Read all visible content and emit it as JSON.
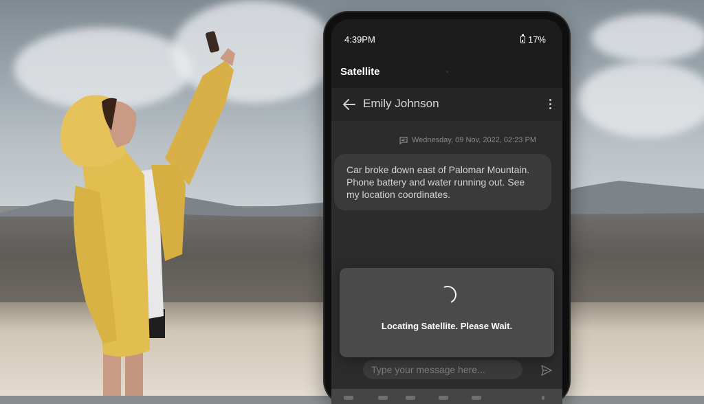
{
  "status_bar": {
    "time": "4:39PM",
    "battery": "17%"
  },
  "app": {
    "title": "Satellite"
  },
  "chat_header": {
    "contact_name": "Emily Johnson"
  },
  "conversation": {
    "timestamp": "Wednesday, 09 Nov, 2022, 02:23 PM",
    "message": "Car broke down east of Palomar Mountain. Phone battery and water running out. See my location coordinates."
  },
  "composer": {
    "placeholder": "Type your message here..."
  },
  "dialog": {
    "text": "Locating Satellite. Please Wait."
  },
  "colors": {
    "screen_bg": "#1c1c1c",
    "chat_bg": "#2c2c2c",
    "bubble_bg": "#3a3a3a",
    "dialog_bg": "#4a4a4a",
    "jacket": "#e2bd4f"
  },
  "icons": [
    "back-arrow-icon",
    "kebab-menu-icon",
    "message-icon",
    "send-icon",
    "battery-icon",
    "spinner-icon"
  ]
}
